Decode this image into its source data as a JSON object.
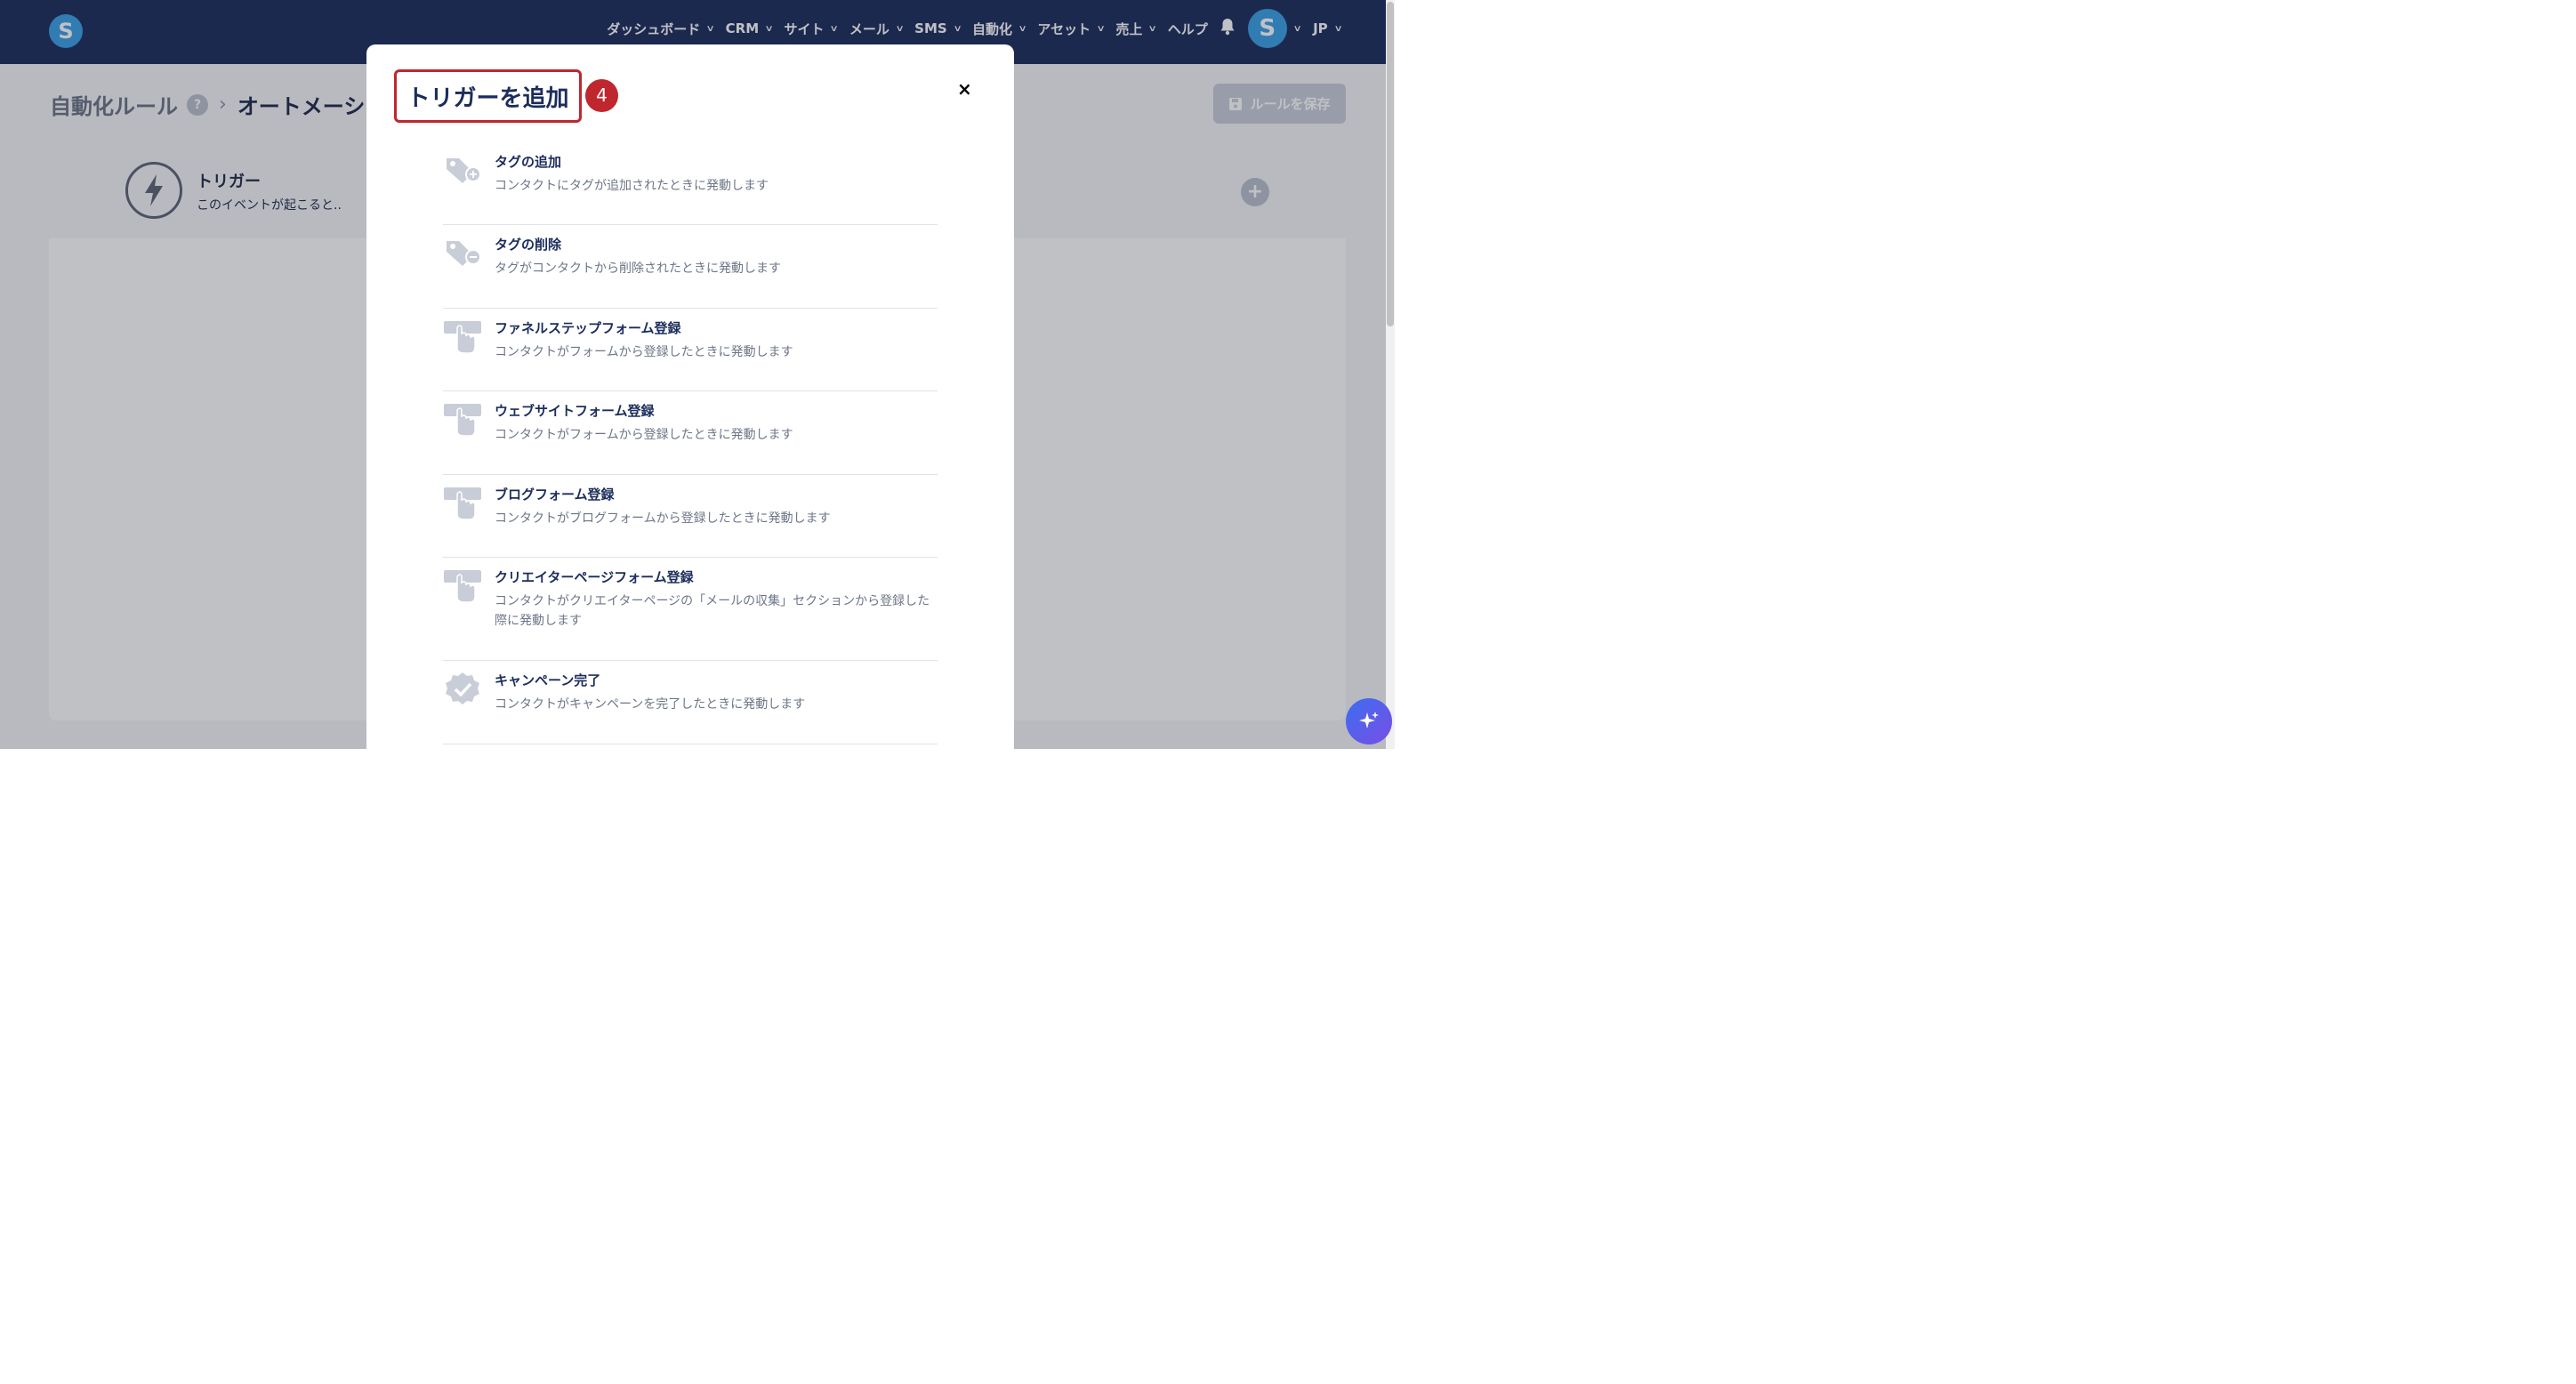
{
  "nav": {
    "items": [
      {
        "label": "ダッシュボード"
      },
      {
        "label": "CRM"
      },
      {
        "label": "サイト"
      },
      {
        "label": "メール"
      },
      {
        "label": "SMS"
      },
      {
        "label": "自動化"
      },
      {
        "label": "アセット"
      },
      {
        "label": "売上"
      }
    ],
    "help": "ヘルプ",
    "language": "JP",
    "logo_letter": "S",
    "avatar_letter": "S"
  },
  "breadcrumb": {
    "root": "自動化ルール",
    "help": "?",
    "current": "オートメーシ"
  },
  "save_button": {
    "label": "ルールを保存"
  },
  "trigger_card": {
    "title": "トリガー",
    "subtitle": "このイベントが起こると.."
  },
  "modal": {
    "title": "トリガーを追加",
    "step": "4",
    "close": "×",
    "triggers": [
      {
        "title": "タグの追加",
        "desc": "コンタクトにタグが追加されたときに発動します",
        "icon": "tag-add-icon"
      },
      {
        "title": "タグの削除",
        "desc": "タグがコンタクトから削除されたときに発動します",
        "icon": "tag-remove-icon"
      },
      {
        "title": "ファネルステップフォーム登録",
        "desc": "コンタクトがフォームから登録したときに発動します",
        "icon": "form-click-icon"
      },
      {
        "title": "ウェブサイトフォーム登録",
        "desc": "コンタクトがフォームから登録したときに発動します",
        "icon": "form-click-icon"
      },
      {
        "title": "ブログフォーム登録",
        "desc": "コンタクトがブログフォームから登録したときに発動します",
        "icon": "form-click-icon"
      },
      {
        "title": "クリエイターページフォーム登録",
        "desc": "コンタクトがクリエイターページの「メールの収集」セクションから登録した際に発動します",
        "icon": "form-click-icon"
      },
      {
        "title": "キャンペーン完了",
        "desc": "コンタクトがキャンペーンを完了したときに発動します",
        "icon": "badge-check-icon"
      }
    ]
  },
  "colors": {
    "nav_bg": "#1c2d5c",
    "brand_blue": "#3aa0e6",
    "highlight_red": "#c0262e"
  }
}
